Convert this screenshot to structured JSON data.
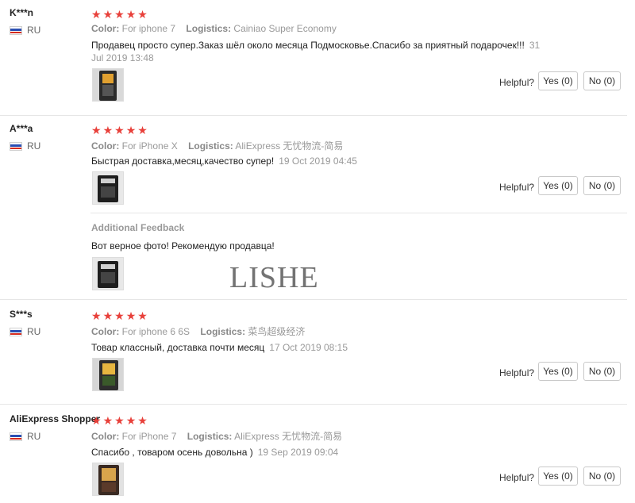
{
  "helpful_label": "Helpful?",
  "watermark": "LISHE",
  "colors": {
    "star": "#e8403a",
    "flag_white": "#ffffff",
    "flag_blue": "#2a4fb3",
    "flag_red": "#d52b1e"
  },
  "reviews": [
    {
      "user": "K***n",
      "country": "RU",
      "rating": 5,
      "color_label": "Color:",
      "color_value": "For iphone 7",
      "logistics_label": "Logistics:",
      "logistics_value": "Cainiao Super Economy",
      "text": "Продавец просто супер.Заказ шёл около месяца Подмосковье.Спасибо за приятный подарочек!!!",
      "date": "31 Jul 2019 13:48",
      "yes_label": "Yes (0)",
      "no_label": "No (0)"
    },
    {
      "user": "A***a",
      "country": "RU",
      "rating": 5,
      "color_label": "Color:",
      "color_value": "For iPhone X",
      "logistics_label": "Logistics:",
      "logistics_value": "AliExpress 无忧物流-简易",
      "text": "Быстрая доставка,месяц,качество супер!",
      "date": "19 Oct 2019 04:45",
      "yes_label": "Yes (0)",
      "no_label": "No (0)",
      "additional_title": "Additional Feedback",
      "additional_text": "Вот верное фото! Рекомендую продавца!"
    },
    {
      "user": "S***s",
      "country": "RU",
      "rating": 5,
      "color_label": "Color:",
      "color_value": "For iphone 6 6S",
      "logistics_label": "Logistics:",
      "logistics_value": "菜鸟超级经济",
      "text": "Товар классный, доставка почти месяц",
      "date": "17 Oct 2019 08:15",
      "yes_label": "Yes (0)",
      "no_label": "No (0)"
    },
    {
      "user": "AliExpress Shopper",
      "country": "RU",
      "rating": 5,
      "color_label": "Color:",
      "color_value": "For iPhone 7",
      "logistics_label": "Logistics:",
      "logistics_value": "AliExpress 无忧物流-简易",
      "text": "Спасибо , товаром осень довольна )",
      "date": "19 Sep 2019 09:04",
      "yes_label": "Yes (0)",
      "no_label": "No (0)"
    }
  ]
}
